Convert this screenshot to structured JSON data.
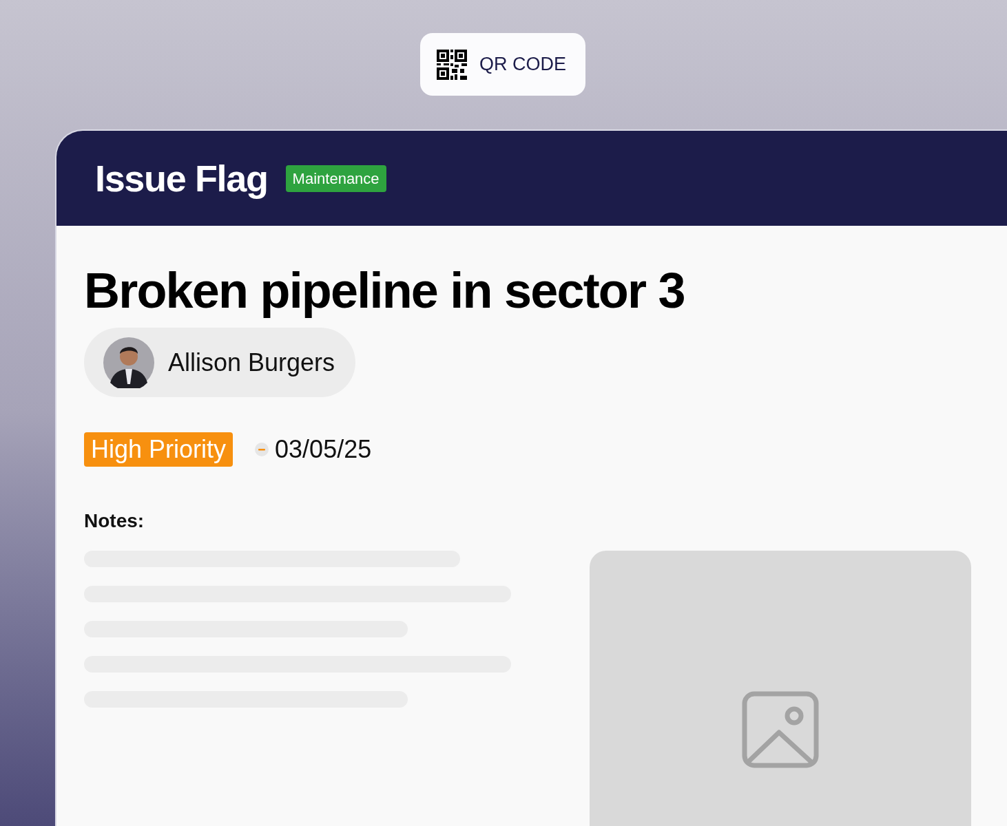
{
  "qr_button": {
    "label": "QR CODE"
  },
  "header": {
    "title": "Issue Flag",
    "tag": "Maintenance"
  },
  "issue": {
    "title": "Broken pipeline in sector 3",
    "assignee": "Allison Burgers",
    "priority": "High Priority",
    "date": "03/05/25"
  },
  "notes": {
    "label": "Notes:"
  }
}
